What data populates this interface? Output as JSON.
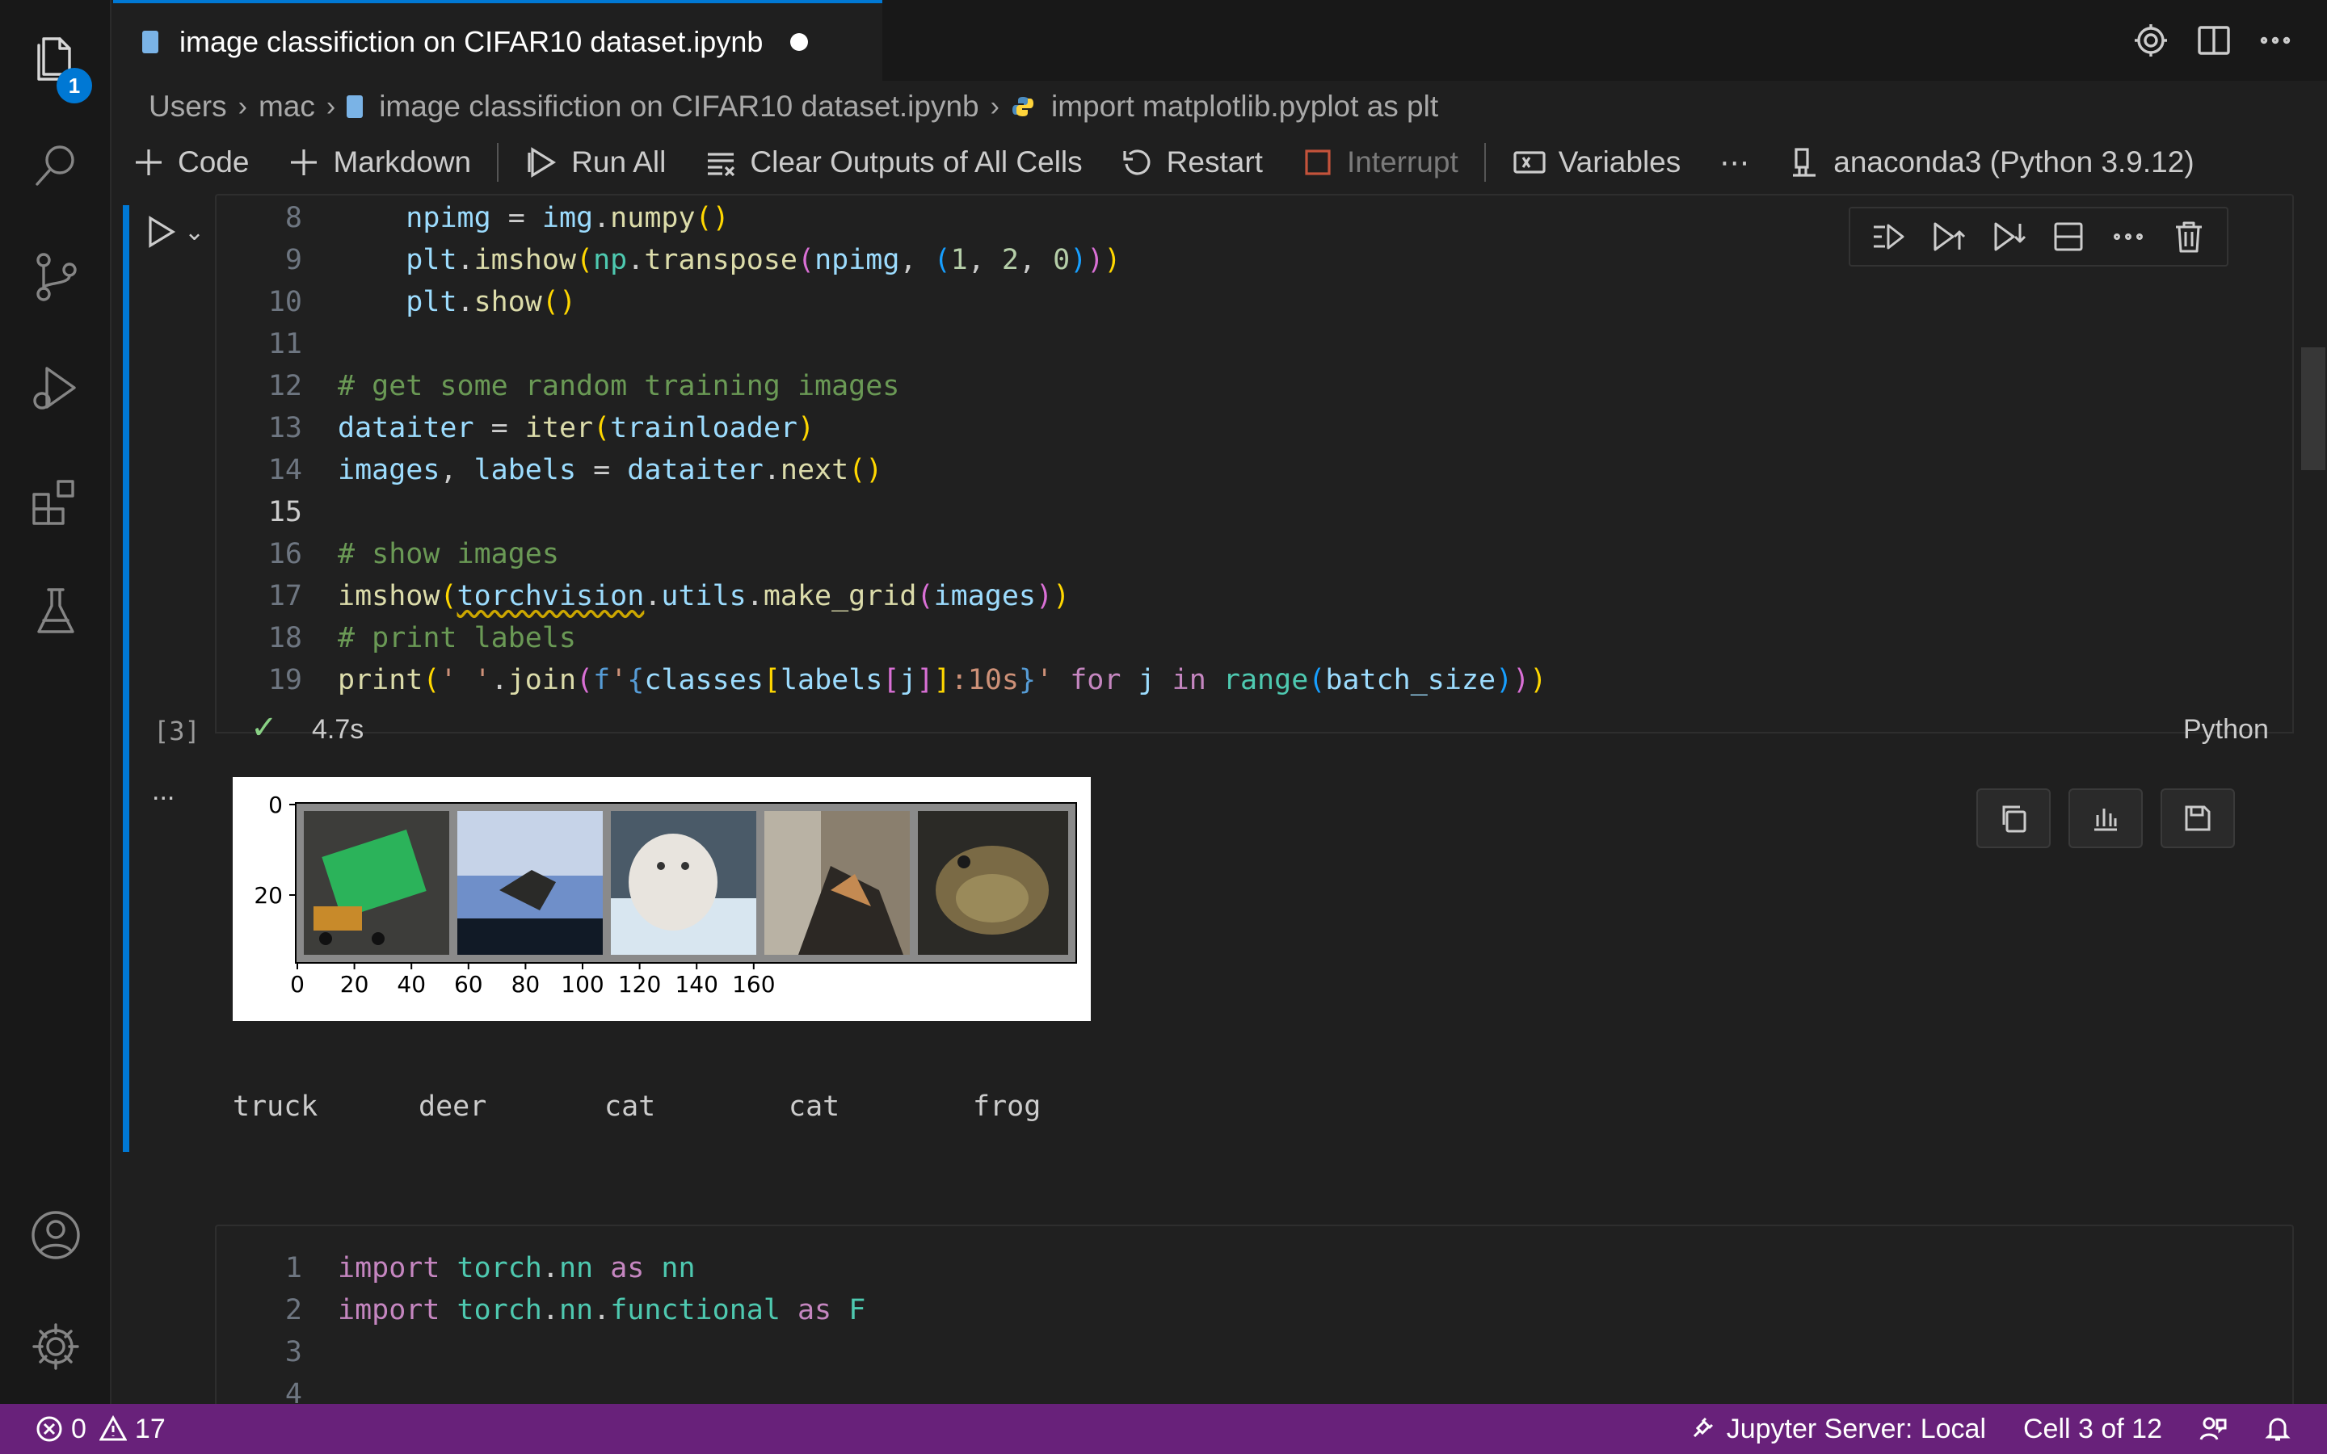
{
  "activity_bar": {
    "explorer_badge": "1"
  },
  "tab": {
    "title": "image classifiction on CIFAR10 dataset.ipynb"
  },
  "breadcrumb": {
    "items": [
      "Users",
      "mac",
      "image classifiction on CIFAR10 dataset.ipynb",
      "import matplotlib.pyplot as plt"
    ]
  },
  "toolbar": {
    "code": "Code",
    "markdown": "Markdown",
    "run_all": "Run All",
    "clear_outputs": "Clear Outputs of All Cells",
    "restart": "Restart",
    "interrupt": "Interrupt",
    "variables": "Variables",
    "more": "⋯",
    "kernel": "anaconda3 (Python 3.9.12)"
  },
  "cell1": {
    "line_numbers": [
      "8",
      "9",
      "10",
      "11",
      "12",
      "13",
      "14",
      "15",
      "16",
      "17",
      "18",
      "19"
    ],
    "execution_count": "[3]",
    "status_check": "✓",
    "duration": "4.7s",
    "language": "Python",
    "output_more": "...",
    "labels": [
      "truck",
      "deer",
      "cat",
      "cat",
      "frog"
    ],
    "plot": {
      "y_ticks": [
        "0",
        "20"
      ],
      "x_ticks": [
        "0",
        "20",
        "40",
        "60",
        "80",
        "100",
        "120",
        "140",
        "160"
      ]
    }
  },
  "cell2": {
    "line_numbers": [
      "1",
      "2",
      "3",
      "4"
    ]
  },
  "statusbar": {
    "errors": "0",
    "warnings": "17",
    "jupyter": "Jupyter Server: Local",
    "cell_position": "Cell 3 of 12"
  }
}
